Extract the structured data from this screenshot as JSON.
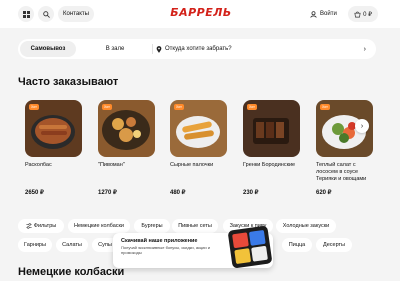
{
  "header": {
    "contacts_label": "Контакты",
    "logo_text": "БАРРЕЛЬ",
    "login_label": "Войти",
    "cart_total": "0 ₽"
  },
  "delivery": {
    "pickup_label": "Самовывоз",
    "hall_label": "В зале",
    "address_placeholder": "Откуда хотите забрать?"
  },
  "popular": {
    "title": "Часто заказывают",
    "items": [
      {
        "name": "Расколбас",
        "price": "2650 ₽",
        "color": "#7a4a2a",
        "badge": "Хит"
      },
      {
        "name": "\"Пивоман\"",
        "price": "1270 ₽",
        "color": "#b8823e",
        "badge": "Хит"
      },
      {
        "name": "Сырные палочки",
        "price": "480 ₽",
        "color": "#d9a14a",
        "badge": "Хит"
      },
      {
        "name": "Гренки Бородинские",
        "price": "230 ₽",
        "color": "#5a3a22",
        "badge": "Хит"
      },
      {
        "name": "Теплый салат с лососем в соусе Терияки и овощами",
        "price": "620 ₽",
        "color": "#6d8a4a",
        "badge": "Хит"
      }
    ]
  },
  "chips_row1": [
    "Фильтры",
    "Немецкие колбаски",
    "Бургеры",
    "Пивные сеты",
    "Закуски к пиву",
    "Холодные закуски"
  ],
  "chips_row2": [
    "Гарниры",
    "Салаты",
    "Супы",
    "Пицца",
    "Десерты"
  ],
  "section2_title": "Немецкие колбаски",
  "promo": {
    "title": "Скачивай наше приложение",
    "text": "Получай эксклюзивные бонусы, скидки, акции и промокоды"
  },
  "colors": {
    "brand": "#d3221a",
    "badge": "#ff8a2a"
  }
}
